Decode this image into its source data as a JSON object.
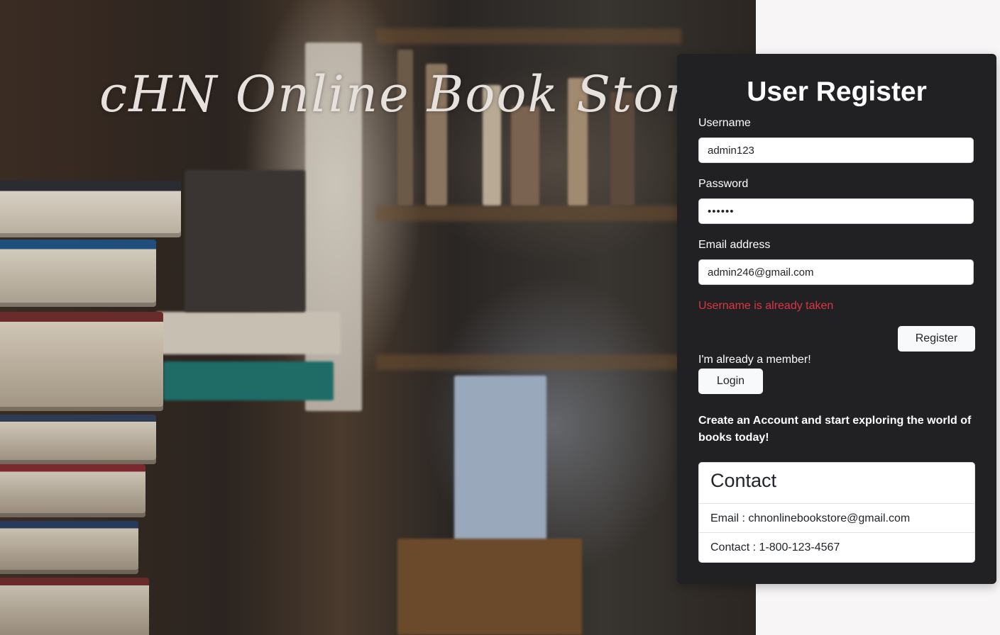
{
  "hero": {
    "title": "cHN Online Book Store"
  },
  "register": {
    "title": "User Register",
    "username_label": "Username",
    "username_value": "admin123",
    "password_label": "Password",
    "password_value": "••••••",
    "email_label": "Email address",
    "email_value": "admin246@gmail.com",
    "error_message": "Username is already taken",
    "register_button": "Register",
    "member_text": "I'm already a member!",
    "login_button": "Login",
    "promo_text": "Create an Account and start exploring the world of books today!"
  },
  "contact": {
    "heading": "Contact",
    "email_line": "Email : chnonlinebookstore@gmail.com",
    "phone_line": "Contact : 1-800-123-4567"
  },
  "colors": {
    "panel_bg": "#212124",
    "error": "#dc3545",
    "button_bg": "#f8f9fa"
  }
}
